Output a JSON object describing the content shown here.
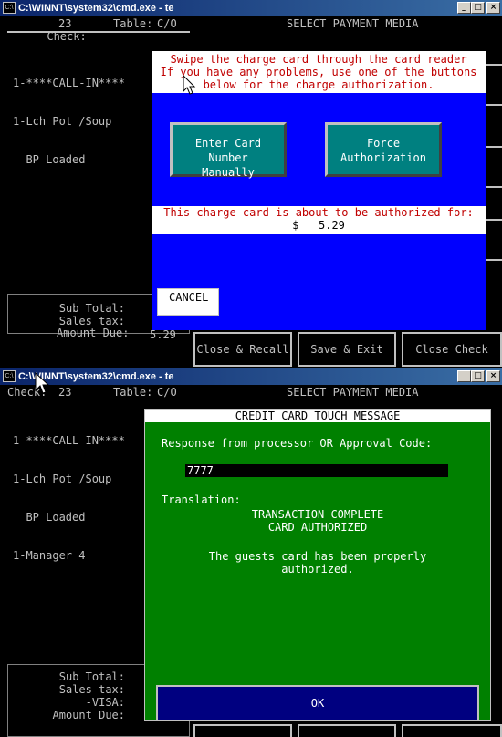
{
  "window1": {
    "title": "C:\\WINNT\\system32\\cmd.exe - te",
    "header": {
      "check_label": "Check:",
      "check_no": "23",
      "table_label": "Table:",
      "table_value": "C/O",
      "screen_title": "SELECT PAYMENT MEDIA"
    },
    "items": [
      "1-****CALL-IN****",
      "1-Lch Pot /Soup",
      "  BP Loaded"
    ],
    "totals": {
      "subtotal_label": "Sub Total:",
      "tax_label": "Sales tax:",
      "due_label": "Amount Due:",
      "due_value": "5.29"
    },
    "buttons": {
      "close_recall": "Close & Recall",
      "save_exit": "Save & Exit",
      "close_check": "Close Check"
    },
    "dialog": {
      "message_lines": [
        "Swipe the charge card through the card reader",
        "If you have any problems, use one of the buttons",
        "below for the charge authorization."
      ],
      "enter_card_line1": "Enter Card Number",
      "enter_card_line2": "Manually",
      "force_line1": "Force",
      "force_line2": "Authorization",
      "auth_text": "This charge card is about to be authorized for:",
      "currency": "$",
      "amount": "5.29",
      "cancel": "CANCEL"
    }
  },
  "window2": {
    "title": "C:\\WINNT\\system32\\cmd.exe - te",
    "header": {
      "check_label": "Check:",
      "check_no": "23",
      "table_label": "Table:",
      "table_value": "C/O",
      "screen_title": "SELECT PAYMENT MEDIA"
    },
    "items": [
      "1-****CALL-IN****",
      "1-Lch Pot /Soup",
      "  BP Loaded",
      "1-Manager 4"
    ],
    "totals": {
      "subtotal_label": "Sub Total:",
      "tax_label": "Sales tax:",
      "visa_label": "-VISA:",
      "due_label": "Amount Due:"
    },
    "dialog": {
      "title": "CREDIT CARD TOUCH MESSAGE",
      "response_label": "Response from processor OR Approval Code:",
      "approval_code": "7777",
      "translation_label": "Translation:",
      "translation_line1": "TRANSACTION COMPLETE",
      "translation_line2": "CARD AUTHORIZED",
      "message_line1": "The guests card has been properly",
      "message_line2": "authorized.",
      "ok": "OK"
    }
  },
  "window_buttons": {
    "minimize": "_",
    "maximize": "□",
    "close": "×"
  },
  "colors": {
    "titlebar": "#0a246a",
    "dialog1_bg": "#0000ff",
    "dialog2_bg": "#008000",
    "teal_button": "#008080",
    "ok_button": "#000080",
    "warning_text": "#c00000"
  }
}
